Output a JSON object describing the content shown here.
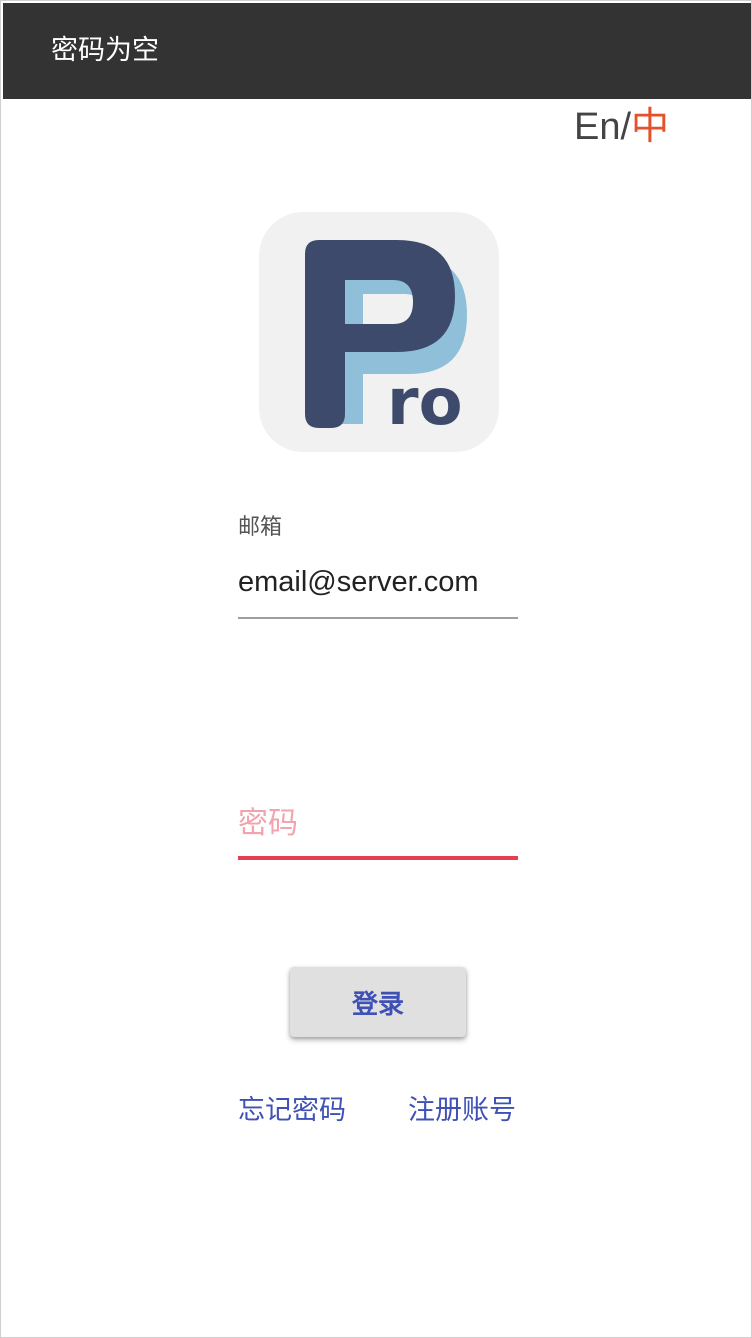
{
  "toolbar": {
    "title": "密码为空"
  },
  "language": {
    "en_label": "En",
    "separator": "/",
    "zh_label": "中",
    "selected": "zh"
  },
  "logo": {
    "text": "Pro",
    "colors": {
      "background": "#f1f1f1",
      "dark": "#3d4a6b",
      "light": "#8fbfd9"
    }
  },
  "form": {
    "email": {
      "label": "邮箱",
      "value": "email@server.com"
    },
    "password": {
      "placeholder": "密码",
      "value": "",
      "error": true
    },
    "login_label": "登录"
  },
  "links": {
    "forgot_password": "忘记密码",
    "register": "注册账号"
  },
  "colors": {
    "toolbar": "#333333",
    "accent": "#3f51b5",
    "error": "#e73f52",
    "lang_active": "#e4512b"
  }
}
